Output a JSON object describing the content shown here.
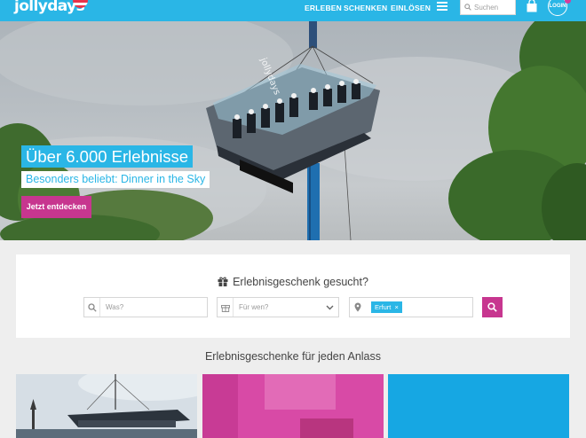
{
  "header": {
    "logo": "jollydays",
    "nav": [
      "ERLEBEN",
      "SCHENKEN",
      "EINLÖSEN"
    ],
    "search_placeholder": "Suchen",
    "login_label": "LOGIN"
  },
  "hero": {
    "title": "Über 6.000 Erlebnisse",
    "subtitle": "Besonders beliebt: Dinner in the Sky",
    "cta": "Jetzt entdecken",
    "crane_text": "jollydays"
  },
  "search": {
    "heading": "Erlebnisgeschenk gesucht?",
    "what_placeholder": "Was?",
    "for_whom_placeholder": "Für wen?",
    "location_chip": "Erfurt",
    "chip_remove": "×"
  },
  "section": {
    "heading": "Erlebnisgeschenke für jeden Anlass"
  },
  "colors": {
    "brand_blue": "#2ab6e6",
    "brand_magenta": "#c7368f"
  }
}
